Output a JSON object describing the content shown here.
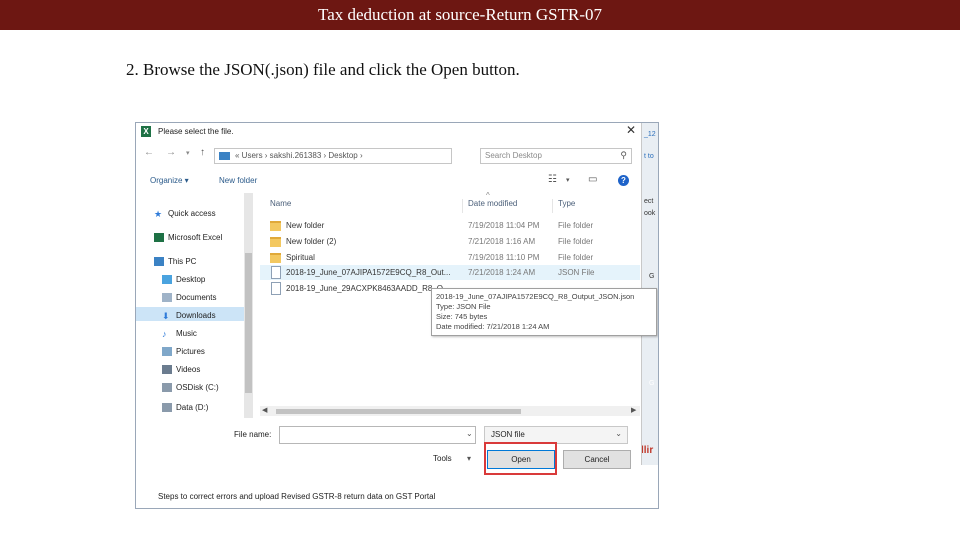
{
  "slide": {
    "title": "Tax deduction at source-Return GSTR-07",
    "instruction": "2. Browse the JSON(.json) file and click the Open button."
  },
  "dialog": {
    "title": "Please select the file.",
    "close": "✕",
    "address": {
      "crumbs": "«  Users  ›  sakshi.261383  ›  Desktop  ›"
    },
    "search_placeholder": "Search Desktop",
    "toolbar": {
      "organize": "Organize ▾",
      "new_folder": "New folder"
    },
    "sidebar": {
      "quick_access": "Quick access",
      "excel": "Microsoft Excel",
      "this_pc": "This PC",
      "desktop": "Desktop",
      "documents": "Documents",
      "downloads": "Downloads",
      "music": "Music",
      "pictures": "Pictures",
      "videos": "Videos",
      "osdisk": "OSDisk (C:)",
      "data": "Data (D:)"
    },
    "columns": {
      "name": "Name",
      "date": "Date modified",
      "type": "Type"
    },
    "files": [
      {
        "name": "New folder",
        "date": "7/19/2018 11:04 PM",
        "type": "File folder"
      },
      {
        "name": "New folder (2)",
        "date": "7/21/2018 1:16 AM",
        "type": "File folder"
      },
      {
        "name": "Spiritual",
        "date": "7/19/2018 11:10 PM",
        "type": "File folder"
      },
      {
        "name": "2018-19_June_07AJIPA1572E9CQ_R8_Out...",
        "date": "7/21/2018 1:24 AM",
        "type": "JSON File"
      },
      {
        "name": "2018-19_June_29ACXPK8463AADD_R8_O..."
      }
    ],
    "tooltip": {
      "line1": "2018-19_June_07AJIPA1572E9CQ_R8_Output_JSON.json",
      "line2": "Type: JSON File",
      "line3": "Size: 745 bytes",
      "line4": "Date modified: 7/21/2018 1:24 AM"
    },
    "file_name_label": "File name:",
    "file_name_value": "",
    "file_type": "JSON file",
    "tools": "Tools",
    "open_button": "Open",
    "cancel_button": "Cancel"
  },
  "background": {
    "tab_partial_1": "_12",
    "tab_partial_2": "t to",
    "side_partial_1": "ect",
    "side_partial_2": "ook",
    "g1": "G",
    "g2": "G",
    "red_partial": "llir",
    "note": "Steps to correct errors and upload Revised GSTR-8 return data on GST Portal"
  }
}
